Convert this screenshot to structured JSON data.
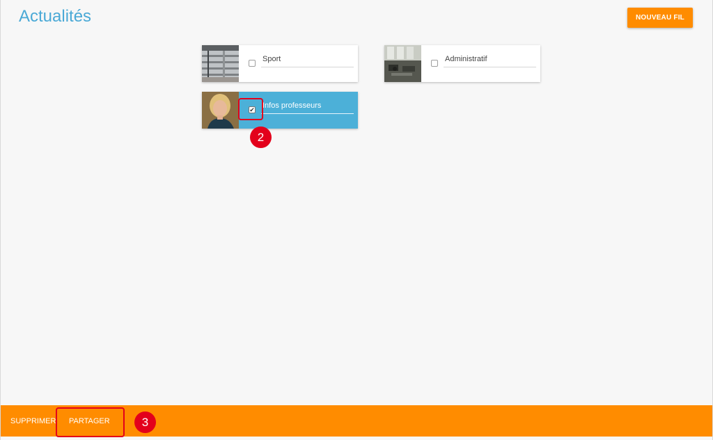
{
  "header": {
    "title": "Actualités",
    "new_feed_label": "NOUVEAU FIL"
  },
  "feeds": [
    {
      "label": "Sport",
      "checked": false,
      "thumbnail": "building-icon"
    },
    {
      "label": "Administratif",
      "checked": false,
      "thumbnail": "office-icon"
    },
    {
      "label": "Infos professeurs",
      "checked": true,
      "thumbnail": "person-photo"
    }
  ],
  "annotations": [
    {
      "number": "2"
    },
    {
      "number": "3"
    }
  ],
  "bottom_bar": {
    "delete_label": "SUPPRIMER",
    "share_label": "PARTAGER"
  },
  "colors": {
    "accent": "#ff8c00",
    "title": "#4aa9d6",
    "selected_card": "#4cb0d8",
    "annotation": "#e3001b"
  }
}
